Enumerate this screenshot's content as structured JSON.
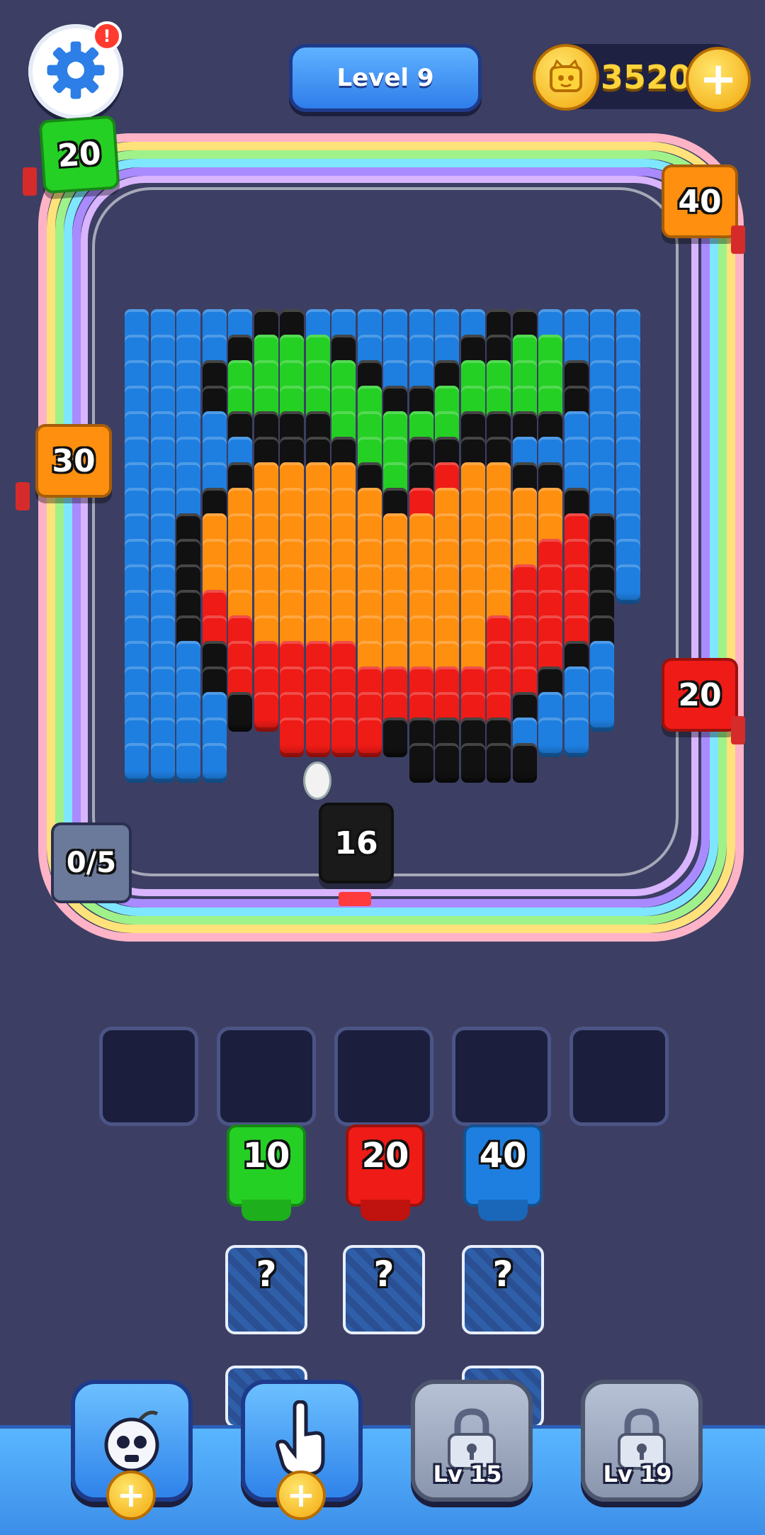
{
  "header": {
    "settings_icon": "gear-icon",
    "notification_mark": "!",
    "level_label": "Level 9",
    "coins": "3520",
    "coin_add_label": "+"
  },
  "colors": {
    "background": "#3c3f63",
    "blue": "#1e7fe0",
    "green": "#25d024",
    "orange": "#ff8f0f",
    "red": "#ee1b16",
    "black": "#111111"
  },
  "track_shooters": [
    {
      "value": "20",
      "color": "#25d024"
    },
    {
      "value": "40",
      "color": "#ff8f0f"
    },
    {
      "value": "30",
      "color": "#ff8f0f"
    },
    {
      "value": "20",
      "color": "#ee1b16"
    },
    {
      "value": "16",
      "color": "#111111"
    }
  ],
  "progress": "0/5",
  "queue": {
    "slot_count": 5,
    "units": [
      {
        "value": "10",
        "color": "#25d024"
      },
      {
        "value": "20",
        "color": "#ee1b16"
      },
      {
        "value": "40",
        "color": "#1e7fe0"
      }
    ],
    "mystery_label": "?"
  },
  "boosters": [
    {
      "name": "bomb",
      "icon": "skull-bomb-icon",
      "add": "+"
    },
    {
      "name": "hand",
      "icon": "pointing-hand-icon",
      "add": "+"
    },
    {
      "name": "locked-1",
      "icon": "lock-icon",
      "label": "Lv 15"
    },
    {
      "name": "locked-2",
      "icon": "lock-icon",
      "label": "Lv 19"
    }
  ],
  "pixel_art": {
    "palette": {
      "B": "#1e7fe0",
      "K": "#111111",
      "G": "#25d024",
      "O": "#ff8f0f",
      "R": "#ee1b16",
      ".": null
    },
    "rows": [
      "BBBBBKKBBBBBBBKKBBBB",
      "BBBBKGGGKBBBBKKGGBBB",
      "BBBKGGGGGKBBKGGGGKBB",
      "BBBKGGGGGGKKGGGGGKBB",
      "BBBBKKKKGGGGGKKKKBBB",
      "BBBBBKKKKGGKKKKBBBBB",
      "BBBBKOOOOKGKROOKKBBB",
      "BBBKOOOOOOKROOOOOKBB",
      "BBKOOOOOOOOOOOOOORKB",
      "BBKOOOOOOOOOOOOORRKB",
      "BBKOOOOOOOOOOOORRRKB",
      "BBKROOOOOOOOOOORRRK.",
      "BBKRROOOOOOOOORRRRK.",
      "BBBKRRRRROOOOORRRKB.",
      "BBBKRRRRRRRRRRRRKBB.",
      "BBBBKRRRRRRRRRRKBBB.",
      "BBBB..RRRRKKKKKBBB..",
      "BBBB.......KKKKK...."
    ]
  }
}
